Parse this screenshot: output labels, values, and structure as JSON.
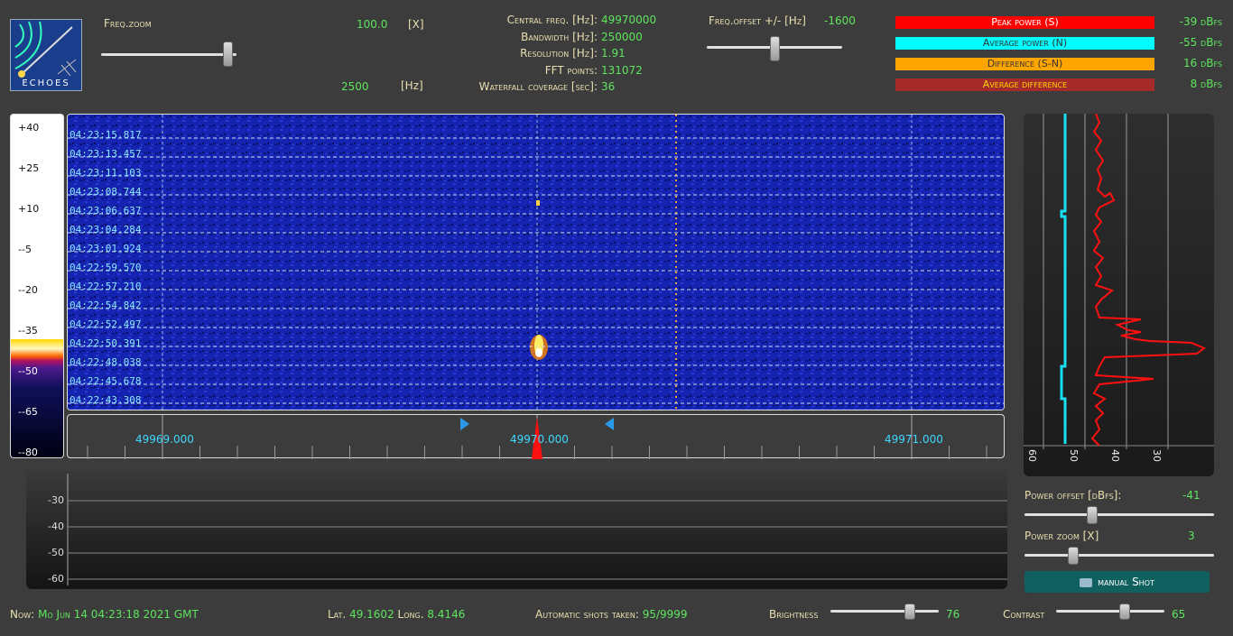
{
  "logo": {
    "text": "ECHOES"
  },
  "freq_zoom": {
    "label": "Freq.zoom",
    "value": "100.0",
    "unit": "[X]",
    "hz_value": "2500",
    "hz_unit": "[Hz]",
    "level": 0.97
  },
  "info": {
    "rows": [
      {
        "label": "Central freq. [Hz]:",
        "value": "49970000"
      },
      {
        "label": "Bandwidth [Hz]:",
        "value": "250000"
      },
      {
        "label": "Resolution [Hz]:",
        "value": "1.91"
      },
      {
        "label": "FFT points:",
        "value": "131072"
      },
      {
        "label": "Waterfall coverage [sec]:",
        "value": "36"
      }
    ]
  },
  "freq_offset": {
    "label": "Freq.offset +/- [Hz]",
    "value": "-1600",
    "level": 0.5
  },
  "power_bars": [
    {
      "label": "Peak power (S)",
      "value": "-39 dBfs",
      "color": "#ff0000",
      "text_color": "#ffffff"
    },
    {
      "label": "Average power (N)",
      "value": "-55 dBfs",
      "color": "#00ffff",
      "text_color": "#333333"
    },
    {
      "label": "Difference (S-N)",
      "value": "16 dBfs",
      "color": "#ffa500",
      "text_color": "#333333"
    },
    {
      "label": "Average difference",
      "value": "8 dBfs",
      "color": "#a52a2a",
      "text_color": "#ffd700"
    }
  ],
  "color_scale": {
    "labels": [
      "+40",
      "+25",
      "+10",
      "--5",
      "--20",
      "--35",
      "--50",
      "--65",
      "--80"
    ]
  },
  "waterfall": {
    "timestamps": [
      "04:23:15.817",
      "04:23:13.457",
      "04:23:11.103",
      "04:23:08.744",
      "04:23:06.637",
      "04:23:04.284",
      "04:23:01.924",
      "04:22:59.570",
      "04:22:57.210",
      "04:22:54.842",
      "04:22:52.497",
      "04:22:50.391",
      "04:22:48.038",
      "04:22:45.678",
      "04:22:43.308"
    ]
  },
  "freq_axis": {
    "ticks": [
      "49969.000",
      "49970.000",
      "49971.000"
    ]
  },
  "power_plot": {
    "ticks": [
      "60",
      "50",
      "40",
      "30"
    ]
  },
  "scope": {
    "ticks": [
      "-30",
      "-40",
      "-50",
      "-60"
    ]
  },
  "power_offset": {
    "label": "Power offset [dBfs]:",
    "value": "-41",
    "level": 0.35
  },
  "power_zoom": {
    "label": "Power zoom [X]",
    "value": "3",
    "level": 0.24
  },
  "manual_shot": {
    "label": "manual Shot"
  },
  "footer": {
    "now_label": "Now:",
    "now_value": "Mo Jun 14 04:23:18 2021 GMT",
    "lat_label": "Lat.",
    "lat_value": "49.1602",
    "long_label": "Long.",
    "long_value": "8.4146",
    "shots_label": "Automatic shots taken:",
    "shots_value": "95/9999",
    "brightness_label": "Brightness",
    "brightness_value": "76",
    "brightness_level": 0.76,
    "contrast_label": "Contrast",
    "contrast_value": "65",
    "contrast_level": 0.65
  }
}
